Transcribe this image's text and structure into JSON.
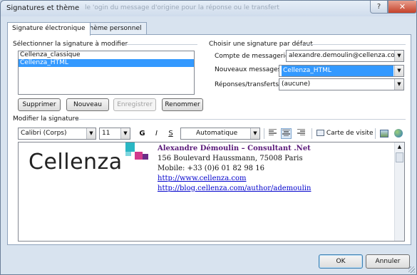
{
  "window": {
    "title": "Signatures et thème",
    "ghost_title": "le 'ogin du message d'origine pour la réponse ou le transfert",
    "help_icon": "question-icon",
    "close_icon": "close-icon"
  },
  "tabs": [
    {
      "label": "Signature électronique",
      "active": true
    },
    {
      "label": "Thème personnel",
      "active": false
    }
  ],
  "select_section": {
    "title": "Sélectionner la signature à modifier",
    "items": [
      "Cellenza_classique",
      "Cellenza_HTML"
    ],
    "selected_index": 1
  },
  "action_buttons": {
    "delete": "Supprimer",
    "new": "Nouveau",
    "save": "Enregistrer",
    "rename": "Renommer"
  },
  "default_section": {
    "title": "Choisir une signature par défaut",
    "account_label": "Compte de messagerie :",
    "account_value": "alexandre.demoulin@cellenza.com",
    "new_messages_label": "Nouveaux messages :",
    "new_messages_value": "Cellenza_HTML",
    "replies_label": "Réponses/transferts :",
    "replies_value": "(aucune)"
  },
  "edit_section": {
    "title": "Modifier la signature",
    "font": "Calibri (Corps)",
    "size": "11",
    "bold": "G",
    "italic": "I",
    "underline": "S",
    "color": "Automatique",
    "business_card_label": "Carte de visite"
  },
  "signature": {
    "logo_text": "Cellenza",
    "name_line": "Alexandre Démoulin – Consultant .Net",
    "address": "156 Boulevard Haussmann, 75008 Paris",
    "mobile": "Mobile: +33 (0)6 01 82 98 16",
    "website": "http://www.cellenza.com",
    "blog": "http://blog.cellenza.com/author/ademoulin"
  },
  "footer": {
    "ok": "OK",
    "cancel": "Annuler"
  },
  "colors": {
    "selection": "#3399ff",
    "logo_teal": "#2ab7c4",
    "logo_pink": "#d13a8c",
    "logo_purple": "#6a2c86",
    "name_color": "#5a1a7a",
    "link_color": "#0000cc"
  }
}
